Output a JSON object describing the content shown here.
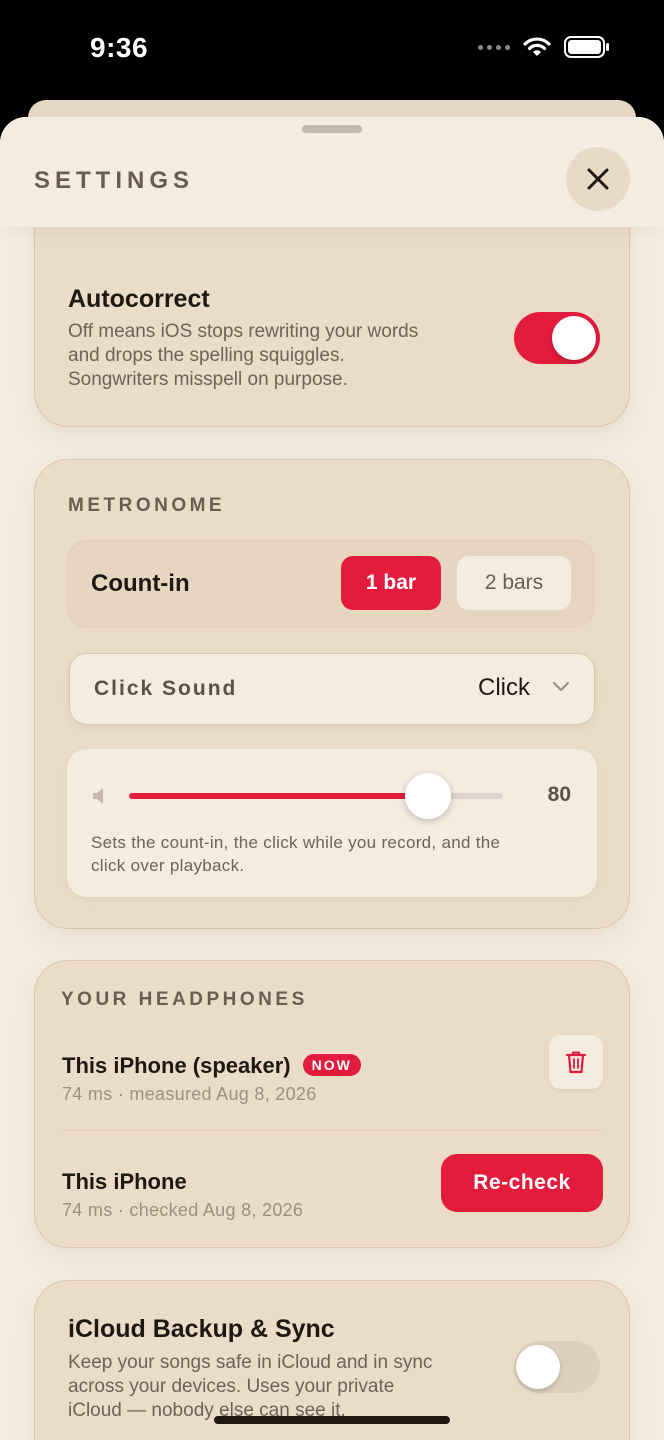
{
  "status_bar": {
    "time": "9:36"
  },
  "sheet": {
    "title": "SETTINGS"
  },
  "autocorrect": {
    "title": "Autocorrect",
    "description_lines": [
      "Off means iOS stops rewriting your words",
      "and drops the spelling squiggles.",
      "Songwriters misspell on purpose."
    ],
    "enabled": true
  },
  "metronome": {
    "section_label": "METRONOME",
    "count_in": {
      "label": "Count-in",
      "options": [
        "1 bar",
        "2 bars"
      ],
      "selected": "1 bar"
    },
    "click_sound": {
      "label": "Click Sound",
      "value": "Click"
    },
    "volume": {
      "value": 80,
      "display": "80",
      "max": 100
    },
    "description_lines": [
      "Sets the count-in, the click while you record, and the",
      "click over playback."
    ]
  },
  "headphones": {
    "section_label": "YOUR HEADPHONES",
    "devices": [
      {
        "name": "This iPhone (speaker)",
        "badge": "NOW",
        "meta": "74 ms · measured Aug 8, 2026"
      },
      {
        "name": "This iPhone",
        "meta": "74 ms · checked Aug 8, 2026",
        "action": "Re-check"
      }
    ]
  },
  "icloud": {
    "title": "iCloud Backup & Sync",
    "description_lines": [
      "Keep your songs safe in iCloud and in sync",
      "across your devices. Uses your private",
      "iCloud — nobody else can see it."
    ],
    "enabled": false
  },
  "colors": {
    "accent": "#e31c3d",
    "card": "#eadcc6",
    "sheet": "#f4ece0"
  }
}
